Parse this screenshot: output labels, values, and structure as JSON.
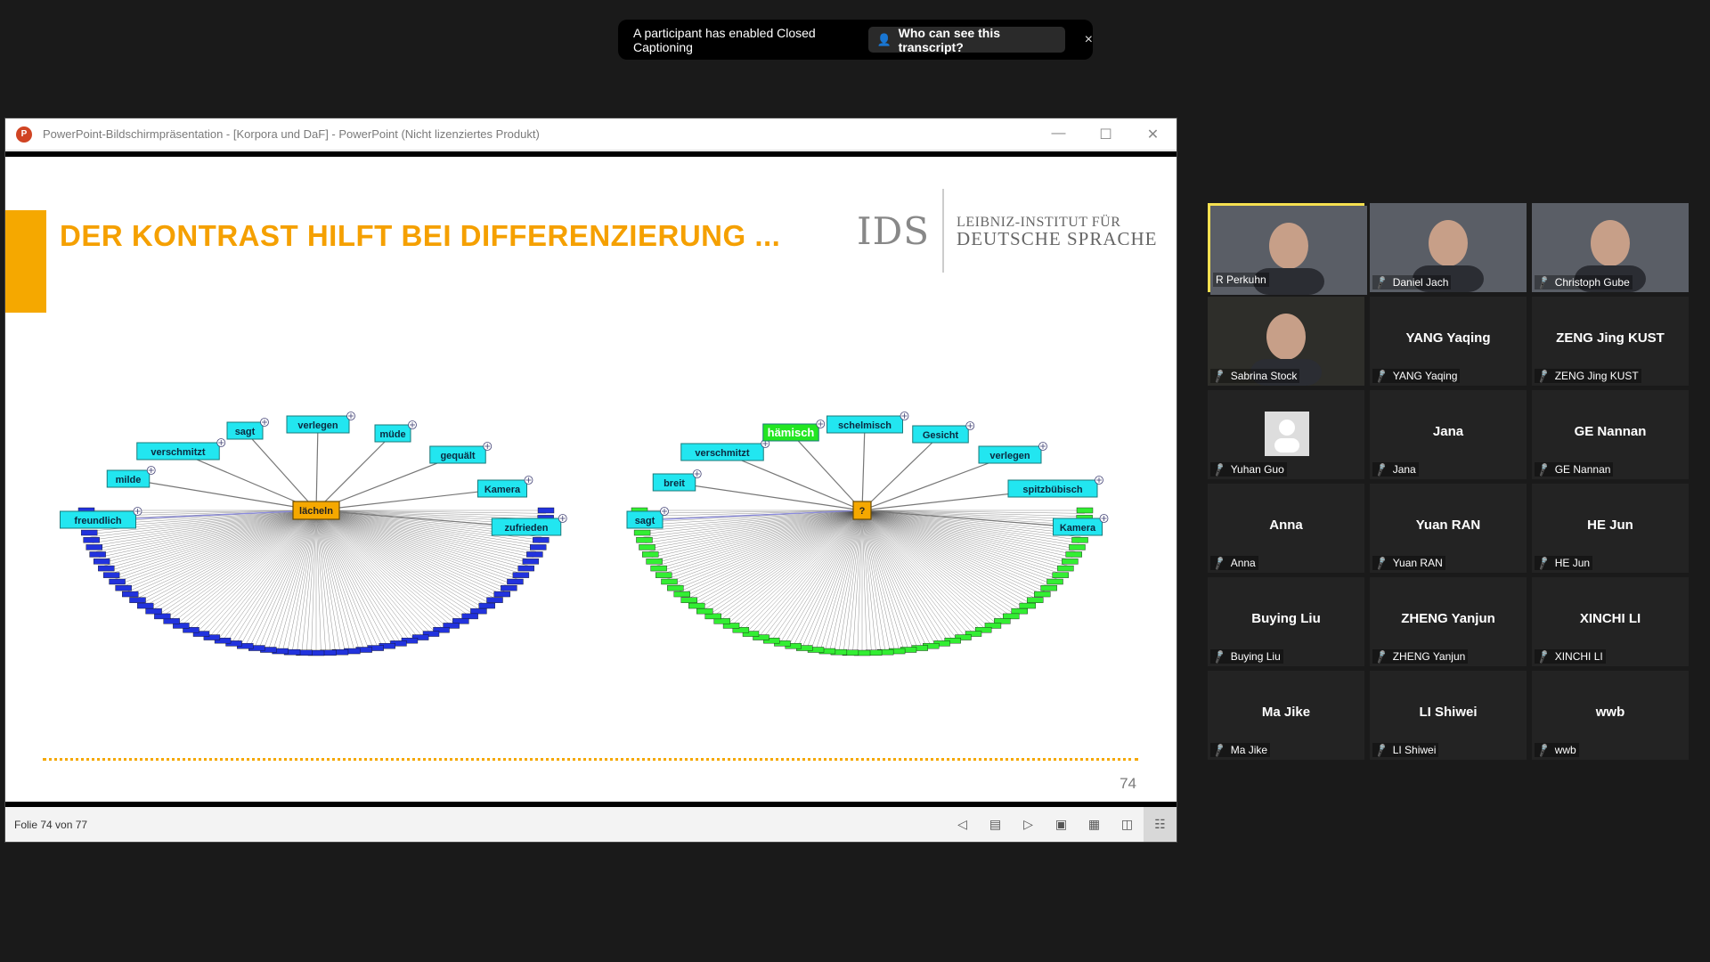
{
  "banner": {
    "message": "A participant has enabled Closed Captioning",
    "button_label": "Who can see this transcript?",
    "button_icon": "person-lock-icon",
    "close_symbol": "×"
  },
  "ppt": {
    "window_title": "PowerPoint-Bildschirmpräsentation - [Korpora und DaF] - PowerPoint (Nicht lizenziertes Produkt)",
    "app_icon": "powerpoint-icon",
    "status_text": "Folie 74 von 77",
    "slide": {
      "title": "DER KONTRAST HILFT BEI DIFFERENZIERUNG ...",
      "logo_mark": "IDS",
      "logo_line1": "LEIBNIZ-INSTITUT FÜR",
      "logo_line2": "DEUTSCHE SPRACHE",
      "page_number": "74",
      "left_graph": {
        "center": "lächeln",
        "nodes": [
          "freundlich",
          "milde",
          "verschmitzt",
          "sagt",
          "verlegen",
          "müde",
          "gequält",
          "Kamera",
          "zufrieden"
        ]
      },
      "right_graph": {
        "center": "?",
        "nodes": [
          "sagt",
          "breit",
          "verschmitzt",
          "hämisch",
          "schelmisch",
          "Gesicht",
          "verlegen",
          "spitzbübisch",
          "Kamera"
        ]
      }
    }
  },
  "participants": [
    {
      "name": "R Perkuhn",
      "big": "",
      "video": true,
      "speaking": true,
      "muted": false
    },
    {
      "name": "Daniel Jach",
      "big": "",
      "video": true,
      "speaking": false,
      "muted": true
    },
    {
      "name": "Christoph Gube",
      "big": "",
      "video": true,
      "speaking": false,
      "muted": true
    },
    {
      "name": "Sabrina Stock",
      "big": "",
      "video": true,
      "speaking": false,
      "muted": true
    },
    {
      "name": "YANG Yaqing",
      "big": "YANG Yaqing",
      "video": false,
      "speaking": false,
      "muted": true
    },
    {
      "name": "ZENG Jing KUST",
      "big": "ZENG Jing KUST",
      "video": false,
      "speaking": false,
      "muted": true
    },
    {
      "name": "Yuhan Guo",
      "big": "",
      "video": false,
      "avatar": true,
      "speaking": false,
      "muted": true
    },
    {
      "name": "Jana",
      "big": "Jana",
      "video": false,
      "speaking": false,
      "muted": true
    },
    {
      "name": "GE Nannan",
      "big": "GE Nannan",
      "video": false,
      "speaking": false,
      "muted": true
    },
    {
      "name": "Anna",
      "big": "Anna",
      "video": false,
      "speaking": false,
      "muted": true
    },
    {
      "name": "Yuan RAN",
      "big": "Yuan RAN",
      "video": false,
      "speaking": false,
      "muted": true
    },
    {
      "name": "HE Jun",
      "big": "HE Jun",
      "video": false,
      "speaking": false,
      "muted": true
    },
    {
      "name": "Buying Liu",
      "big": "Buying Liu",
      "video": false,
      "speaking": false,
      "muted": true
    },
    {
      "name": "ZHENG Yanjun",
      "big": "ZHENG Yanjun",
      "video": false,
      "speaking": false,
      "muted": true
    },
    {
      "name": "XINCHI LI",
      "big": "XINCHI LI",
      "video": false,
      "speaking": false,
      "muted": true
    },
    {
      "name": "Ma Jike",
      "big": "Ma Jike",
      "video": false,
      "speaking": false,
      "muted": true
    },
    {
      "name": "LI Shiwei",
      "big": "LI Shiwei",
      "video": false,
      "speaking": false,
      "muted": true
    },
    {
      "name": "wwb",
      "big": "wwb",
      "video": false,
      "speaking": false,
      "muted": true
    }
  ],
  "colors": {
    "accent_orange": "#f5a800",
    "node_cyan": "#22e6f0",
    "highlight_green": "#22e622",
    "arc_blue": "#2233dd",
    "arc_green": "#33ee33",
    "mute_red": "#e02828",
    "speaker_border": "#f5e050"
  }
}
